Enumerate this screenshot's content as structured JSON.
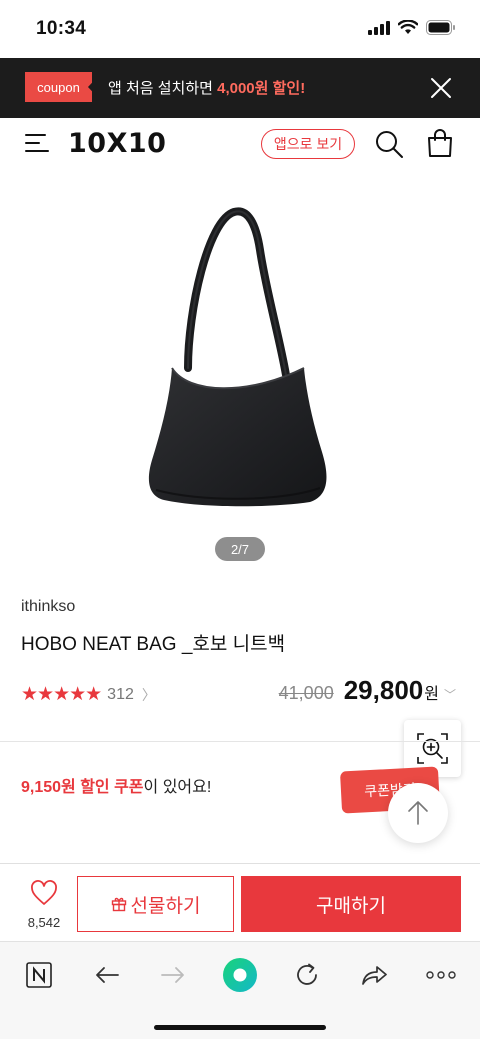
{
  "status_bar": {
    "time": "10:34"
  },
  "banner": {
    "tag": "coupon",
    "message_prefix": "앱 처음 설치하면 ",
    "message_highlight": "4,000원 할인!"
  },
  "header": {
    "logo": "10X10",
    "app_button": "앱으로 보기"
  },
  "gallery": {
    "pager": "2/7"
  },
  "product": {
    "brand": "ithinkso",
    "title": "HOBO NEAT BAG _호보 니트백",
    "stars": "★★★★★",
    "rating": 5,
    "review_count": "312",
    "original_price": "41,000",
    "sale_price": "29,800",
    "currency": "원"
  },
  "coupon": {
    "amount": "9,150원 할인 쿠폰",
    "suffix": "이 있어요!",
    "button": "쿠폰받기"
  },
  "actions": {
    "wish_count": "8,542",
    "gift": "선물하기",
    "buy": "구매하기"
  },
  "colors": {
    "accent": "#e8383d",
    "banner_bg": "#1c1c1c"
  }
}
